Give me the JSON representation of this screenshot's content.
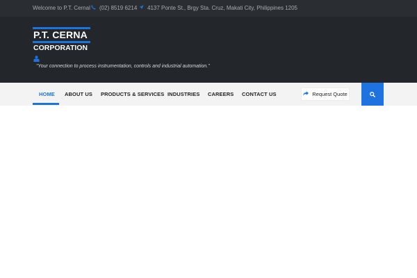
{
  "topbar": {
    "welcome": "Welcome to P.T. Cernal",
    "phone": "(02) 8519 6214",
    "address": "4137 Ponte St., Brgy Sta. Cruz, Makati City, Philippines 1205"
  },
  "header": {
    "logo_line1": "P.T. CERNA",
    "logo_line2": "CORPORATION",
    "tagline": "\"Your connection to process instrumentation, controls and industrial automation.\""
  },
  "nav": {
    "items": [
      {
        "label": "HOME"
      },
      {
        "label": "ABOUT US"
      },
      {
        "label": "PRODUCTS & SERVICES"
      },
      {
        "label": "INDUSTRIES"
      },
      {
        "label": "CAREERS"
      },
      {
        "label": "CONTACT US"
      }
    ],
    "quote_label": "Request Quote"
  },
  "colors": {
    "accent": "#1e73e0",
    "topbar_bg": "#2a2d31",
    "header_bg": "#23262a",
    "nav_bg": "#f3f3f3"
  },
  "icons": [
    "phone-icon",
    "location-arrow-icon",
    "share-arrow-icon",
    "search-icon",
    "person-icon"
  ]
}
